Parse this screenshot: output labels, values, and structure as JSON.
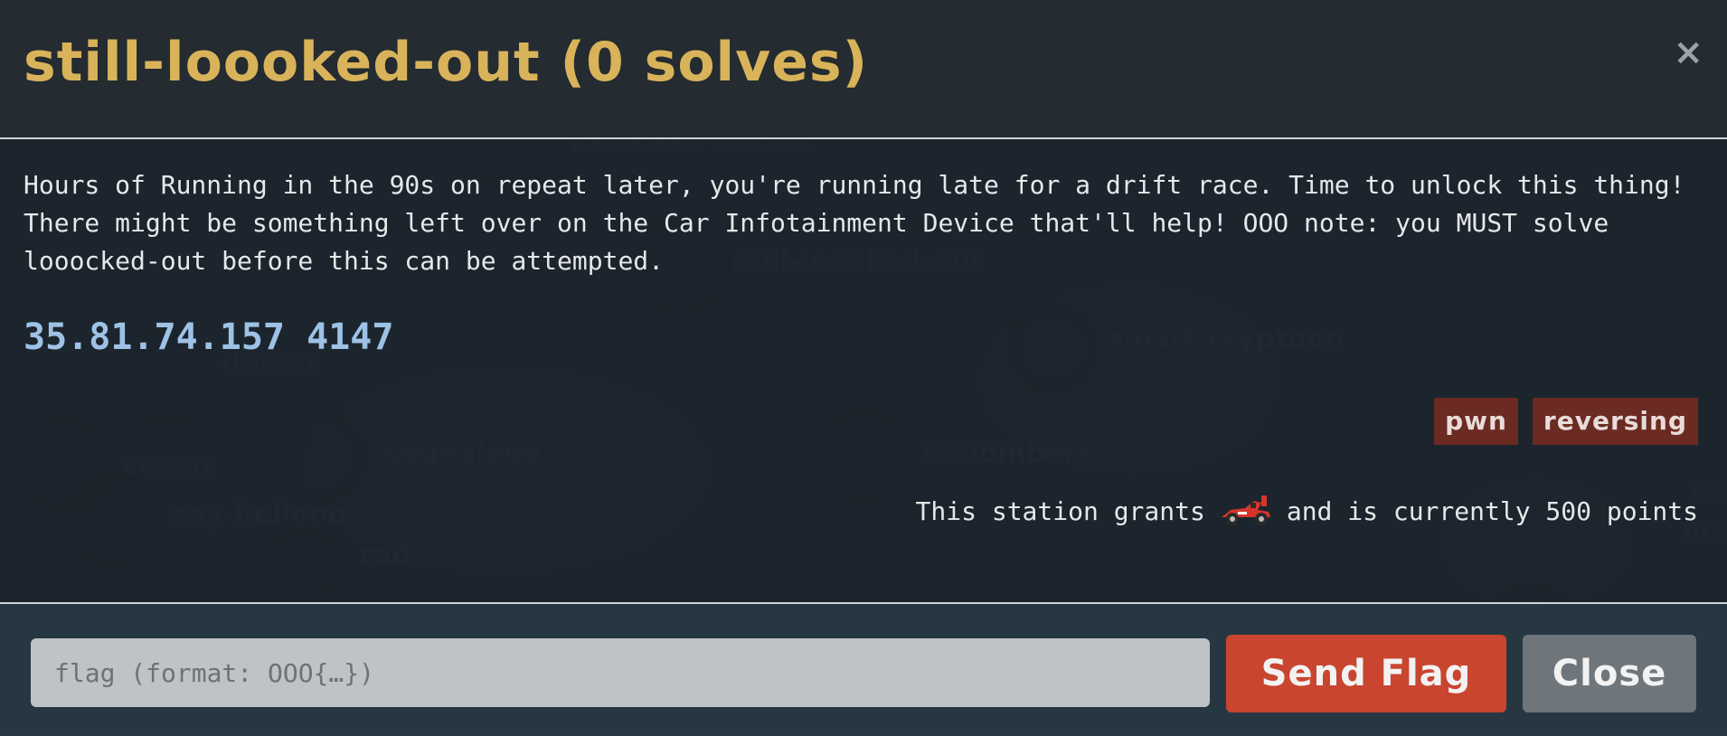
{
  "modal": {
    "title": "still-loooked-out (0 solves)",
    "close_glyph": "×",
    "description": "Hours of Running in the 90s on repeat later, you're running late for a drift race. Time to unlock this thing! There might be something left over on the Car Infotainment Device that'll help! OOO note: you MUST solve looocked-out before this can be attempted.",
    "server": "35.81.74.157 4147",
    "tags": [
      "pwn",
      "reversing"
    ],
    "points_prefix": "This station grants",
    "points_icon": "race-car-icon",
    "points_suffix": "and is currently 500 points"
  },
  "footer": {
    "flag_placeholder": "flag (format: OOO{…})",
    "flag_value": "",
    "send_label": "Send Flag",
    "close_label": "Close"
  },
  "background_labels": [
    "looocked-ooooo",
    "still-loooked-out",
    "smart-cryptooo",
    "damat",
    "cozen",
    "segnalooo",
    "nooombers",
    "say-hellooo",
    "rad",
    "grana-t",
    "ra",
    "mama"
  ],
  "colors": {
    "title": "#d9b35a",
    "server": "#9ec2e6",
    "tag_bg": "#6b2a22",
    "send_button": "#c9452f",
    "close_button": "#6e757b"
  }
}
